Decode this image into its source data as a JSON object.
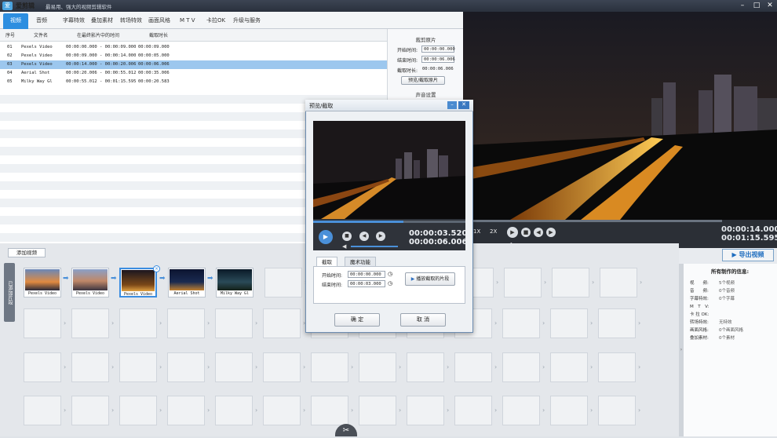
{
  "app": {
    "logo": "爱",
    "name": "爱剪辑",
    "slogan": "最易用、强大的视频剪辑软件"
  },
  "window_buttons": [
    "–",
    "□",
    "✕"
  ],
  "menu": [
    "视频",
    "音频",
    "字幕特效",
    "叠加素材",
    "转场特效",
    "画面风格",
    "M T V",
    "卡拉OK",
    "升级与服务"
  ],
  "table": {
    "headers": [
      "序号",
      "文件名",
      "在最终影片中的时间",
      "截取时长"
    ],
    "rows": [
      {
        "no": "01",
        "file": "Pexels Video",
        "time": "00:00:00.000 - 00:00:09.000",
        "dur": "00:00:09.000"
      },
      {
        "no": "02",
        "file": "Pexels Video",
        "time": "00:00:09.000 - 00:00:14.000",
        "dur": "00:00:05.000"
      },
      {
        "no": "03",
        "file": "Pexels Video",
        "time": "00:00:14.000 - 00:00:20.006",
        "dur": "00:00:06.006"
      },
      {
        "no": "04",
        "file": "Aerial Shot",
        "time": "00:00:20.006 - 00:00:55.012",
        "dur": "00:00:35.006"
      },
      {
        "no": "05",
        "file": "Milky Way Gl",
        "time": "00:00:55.012 - 00:01:15.595",
        "dur": "00:00:20.583"
      }
    ]
  },
  "side": {
    "clip_title": "裁剪原片",
    "start_label": "开始时间:",
    "start_value": "00:00:00.000",
    "end_label": "结束时间:",
    "end_value": "00:00:06.006",
    "dur_label": "截取时长:",
    "dur_value": "00:00:06.006",
    "preview_button": "预览/截取原片",
    "audio_title": "声音设置"
  },
  "preview": {
    "time_current": "00:00:14.000",
    "time_total": "00:01:15.595",
    "speed": "1X",
    "speed2": "2X"
  },
  "export_button": "导出视频",
  "add_video": "添加视频",
  "side_tab": "已添加片段",
  "clips": [
    "Pexels Video",
    "Pexels Video",
    "Pexels Video",
    "Aerial Shot",
    "Milky Way Gl"
  ],
  "info": {
    "title": "所有制作的信息:",
    "rows": [
      {
        "label": "视　　频:",
        "value": "5个视频"
      },
      {
        "label": "音　　频:",
        "value": "0个音频"
      },
      {
        "label": "字幕特效:",
        "value": "0个字幕"
      },
      {
        "label": "M　T　V:",
        "value": ""
      },
      {
        "label": "卡 拉 OK:",
        "value": ""
      },
      {
        "label": "转场特效:",
        "value": "无特效"
      },
      {
        "label": "画面风格:",
        "value": "0个画面风格"
      },
      {
        "label": "叠加素材:",
        "value": "0个素材"
      }
    ]
  },
  "dialog": {
    "title": "预览/截取",
    "time_current": "00:00:03.520",
    "time_total": "00:00:06.006",
    "tab1": "截取",
    "tab2": "魔术功能",
    "start_label": "开始时间:",
    "start_value": "00:00:00.000",
    "end_label": "结束时间:",
    "end_value": "00:00:03.000",
    "play_clip_button": "播放截取的片段",
    "ok": "确 定",
    "cancel": "取 消"
  },
  "colors": {
    "accent": "#2d8ee0",
    "selected_row": "#9cc7ee"
  }
}
